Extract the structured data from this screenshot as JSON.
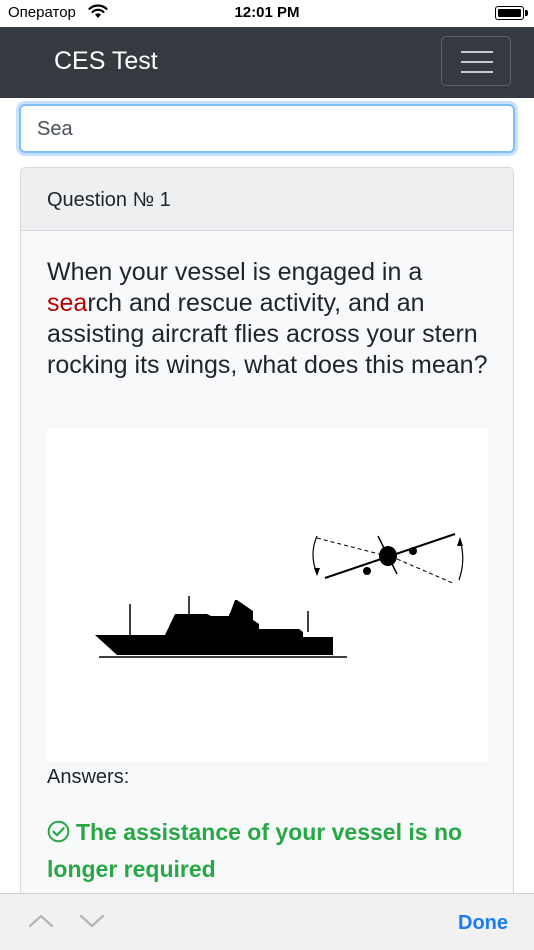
{
  "status_bar": {
    "carrier": "Оператор",
    "time": "12:01 PM"
  },
  "navbar": {
    "title": "CES Test",
    "menu_icon": "hamburger-menu-icon"
  },
  "search": {
    "value": "Sea",
    "placeholder": ""
  },
  "question_card": {
    "header": "Question № 1",
    "question_highlight": "sea",
    "question_before": "When your vessel is engaged in a ",
    "question_after": "rch and rescue activity, and an assisting aircraft flies across your stern rocking its wings, what does this mean?",
    "figure": "ship-and-aircraft-illustration",
    "answers_label": "Answers:",
    "answers": [
      {
        "text": "The assistance of your vessel is no longer required",
        "correct": true
      }
    ]
  },
  "keyboard_toolbar": {
    "prev_icon": "chevron-up-icon",
    "next_icon": "chevron-down-icon",
    "done_label": "Done"
  },
  "colors": {
    "navbar": "#343a40",
    "highlight": "#b30000",
    "correct_answer": "#28a745",
    "done": "#1a7cf5"
  }
}
